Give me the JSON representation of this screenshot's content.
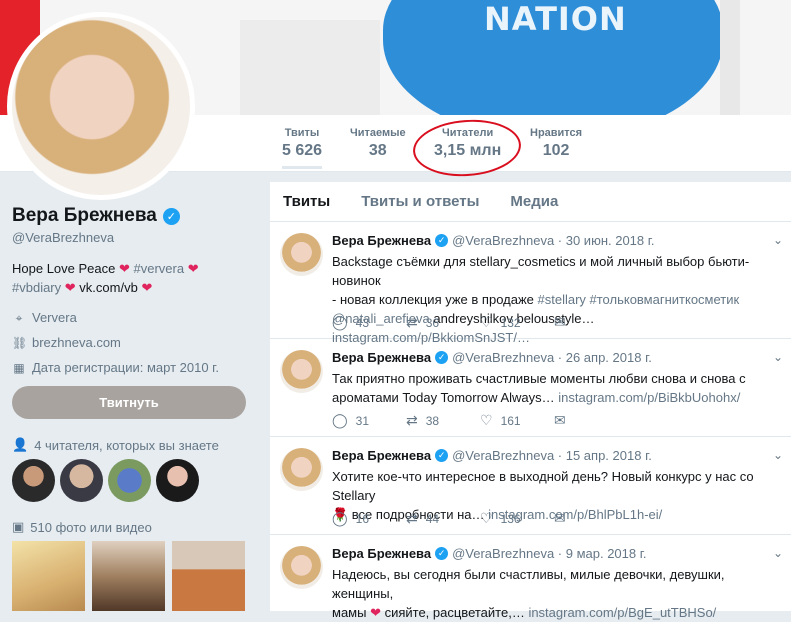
{
  "banner": {
    "text": "NATION"
  },
  "stats": [
    {
      "label": "Твиты",
      "value": "5 626"
    },
    {
      "label": "Читаемые",
      "value": "38"
    },
    {
      "label": "Читатели",
      "value": "3,15 млн"
    },
    {
      "label": "Нравится",
      "value": "102"
    }
  ],
  "profile": {
    "name": "Вера Брежнева",
    "handle": "@VeraBrezhneva",
    "bio1": "Hope Love Peace",
    "bio1_tag": "#ververa",
    "bio2_tag": "#vbdiary",
    "bio2_link": "vk.com/vb",
    "location": "Ververa",
    "website": "brezhneva.com",
    "joined": "Дата регистрации: март 2010 г.",
    "tweet_button": "Твитнуть",
    "followers_known": "4 читателя, которых вы знаете",
    "photos": "510 фото или видео"
  },
  "tabs": [
    "Твиты",
    "Твиты и ответы",
    "Медиа"
  ],
  "tweets": [
    {
      "name": "Вера Брежнева",
      "meta": "@VeraBrezhneva · 30 июн. 2018 г.",
      "line1": "Backstage съёмки для stellary_cosmetics и мой личный выбор бьюти-новинок",
      "line2a": "- новая  коллекция уже в продаже ",
      "line2b": "#stellary #тольковмагниткосметик",
      "line3a": "@natali_arefieva",
      "line3b": " andreyshilkov belousstyle… ",
      "line3c": "instagram.com/p/BkkiomSnJST/…",
      "replies": "43",
      "retweets": "36",
      "likes": "132"
    },
    {
      "name": "Вера Брежнева",
      "meta": "@VeraBrezhneva · 26 апр. 2018 г.",
      "line1": "Так приятно проживать счастливые моменты любви снова и снова с",
      "line2a": "ароматами Today Tomorrow Always… ",
      "line2b": "instagram.com/p/BiBkbUohohx/",
      "replies": "31",
      "retweets": "38",
      "likes": "161"
    },
    {
      "name": "Вера Брежнева",
      "meta": "@VeraBrezhneva · 15 апр. 2018 г.",
      "line1": "Хотите кое-что интересное в выходной день? Новый конкурс у нас со Stellary",
      "line2a": " все подробности на… ",
      "line2b": "instagram.com/p/BhlPbL1h-ei/",
      "replies": "16",
      "retweets": "44",
      "likes": "136"
    },
    {
      "name": "Вера Брежнева",
      "meta": "@VeraBrezhneva · 9 мар. 2018 г.",
      "line1": "Надеюсь, вы сегодня были счастливы, милые девочки, девушки, женщины,",
      "line2a": "мамы ",
      "line2b": " сияйте, расцветайте,… ",
      "line2c": "instagram.com/p/BgE_utTBHSo/"
    }
  ],
  "colors": {
    "accent": "#1da1f2",
    "annotation": "#d90e1e"
  }
}
